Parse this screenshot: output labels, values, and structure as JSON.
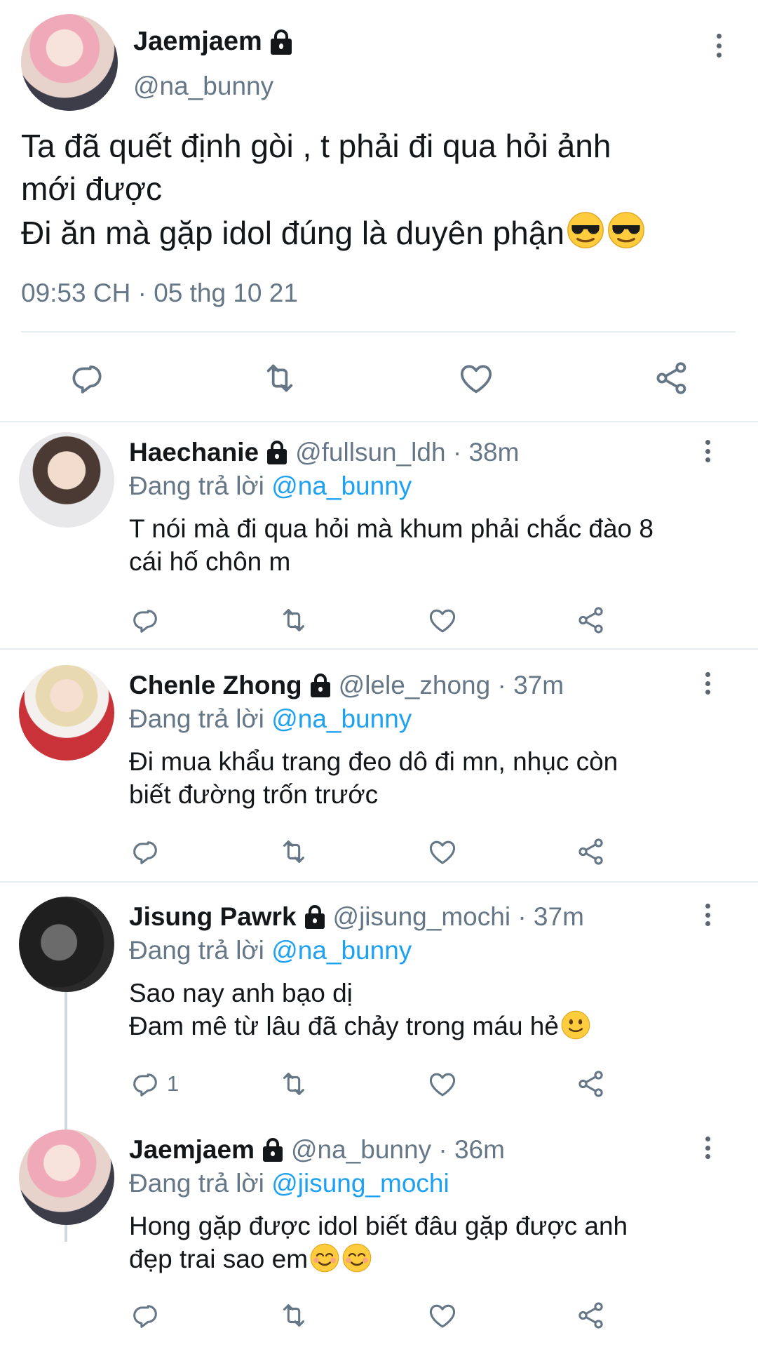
{
  "main_tweet": {
    "name": "Jaemjaem",
    "handle": "@na_bunny",
    "text_line1": "Ta đã quết định gòi , t phải đi qua hỏi ảnh",
    "text_line2": "mới được",
    "text_line3": "Đi ăn mà gặp idol đúng là duyên phận",
    "emoji": "sunglasses-face",
    "timestamp": "09:53 CH · 05 thg 10 21"
  },
  "replies": [
    {
      "name": "Haechanie",
      "handle": "@fullsun_ldh · 38m",
      "replying_prefix": "Đang trả lời",
      "replying_to": "@na_bunny",
      "text_line1": "T nói mà đi qua hỏi mà khum phải chắc đào 8",
      "text_line2": "cái hố chôn m",
      "reply_count": ""
    },
    {
      "name": "Chenle Zhong",
      "handle": "@lele_zhong · 37m",
      "replying_prefix": "Đang trả lời",
      "replying_to": "@na_bunny",
      "text_line1": "Đi mua khẩu trang đeo dô đi mn, nhục còn",
      "text_line2": "biết đường trốn trước",
      "reply_count": ""
    },
    {
      "name": "Jisung Pawrk",
      "handle": "@jisung_mochi · 37m",
      "replying_prefix": "Đang trả lời",
      "replying_to": "@na_bunny",
      "text_line1": "Sao nay anh bạo dị",
      "text_line2": "Đam mê từ lâu đã chảy trong máu hẻ",
      "emoji": "slightly-smiling-face",
      "reply_count": "1"
    },
    {
      "name": "Jaemjaem",
      "handle": "@na_bunny · 36m",
      "replying_prefix": "Đang trả lời",
      "replying_to": "@jisung_mochi",
      "text_line1": "Hong gặp được idol biết đâu gặp được anh",
      "text_line2": "đẹp trai sao em",
      "emoji": "smiling-face-with-smiling-eyes",
      "reply_count": ""
    }
  ],
  "colors": {
    "text": "#14171a",
    "secondary": "#657786",
    "link": "#1da1f2",
    "divider": "#e6ecf0"
  }
}
